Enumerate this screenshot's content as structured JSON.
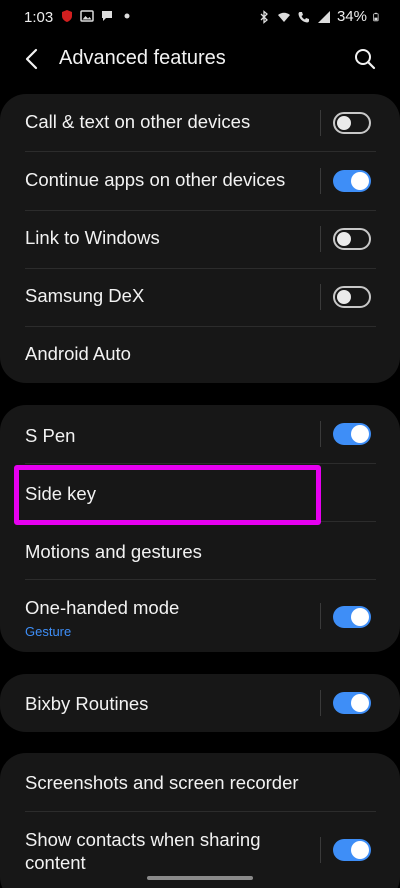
{
  "status_bar": {
    "time": "1:03",
    "battery": "34%",
    "left_icons": [
      "shield-icon",
      "image-icon",
      "message-icon",
      "dot-icon"
    ],
    "right_icons": [
      "bluetooth-icon",
      "wifi-icon",
      "call-icon",
      "signal-icon",
      "battery-icon"
    ]
  },
  "header": {
    "title": "Advanced features",
    "back_icon": "back-arrow-icon",
    "search_icon": "search-icon"
  },
  "groups": [
    {
      "items": [
        {
          "label": "Call & text on other devices",
          "toggle": false
        },
        {
          "label": "Continue apps on other devices",
          "toggle": true
        },
        {
          "label": "Link to Windows",
          "toggle": false
        },
        {
          "label": "Samsung DeX",
          "toggle": false
        },
        {
          "label": "Android Auto"
        }
      ]
    },
    {
      "items": [
        {
          "label": "S Pen",
          "toggle": true
        },
        {
          "label": "Side key",
          "highlighted": true
        },
        {
          "label": "Motions and gestures"
        },
        {
          "label": "One-handed mode",
          "subtitle": "Gesture",
          "toggle": true
        }
      ]
    },
    {
      "items": [
        {
          "label": "Bixby Routines",
          "toggle": true
        }
      ]
    },
    {
      "items": [
        {
          "label": "Screenshots and screen recorder"
        },
        {
          "label": "Show contacts when sharing",
          "label_line2": "content",
          "toggle": true
        }
      ]
    }
  ],
  "colors": {
    "background": "#000000",
    "card": "#171717",
    "accent": "#3e8ef7",
    "highlight": "#e600f0"
  }
}
